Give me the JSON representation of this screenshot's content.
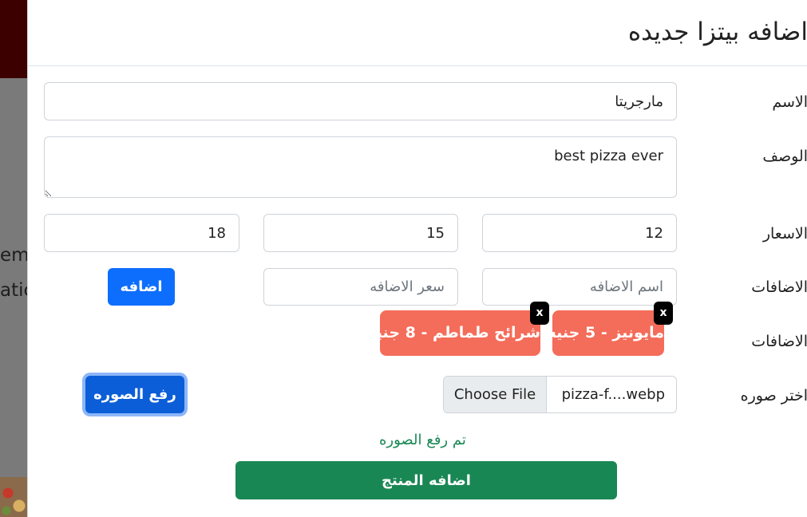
{
  "background": {
    "text_line1": "em",
    "text_line2": "atic"
  },
  "modal": {
    "title": "اضافه بيتزا جديده",
    "name": {
      "label": "الاسم",
      "value": "مارجريتا"
    },
    "description": {
      "label": "الوصف",
      "value": "best pizza ever"
    },
    "prices": {
      "label": "الاسعار",
      "values": [
        "12",
        "15",
        "18"
      ]
    },
    "addon_input": {
      "label": "الاضافات",
      "name_placeholder": "اسم الاضافه",
      "price_placeholder": "سعر الاضافه",
      "add_button": "اضافه"
    },
    "addons_list": {
      "label": "الاضافات",
      "chips": [
        {
          "text": "مايونيز - 5 جنيه",
          "remove": "x"
        },
        {
          "text": "شرائح طماطم - 8 جنيه",
          "remove": "x"
        }
      ]
    },
    "image": {
      "label": "اختر صوره",
      "choose_file": "Choose File",
      "file_name": "pizza-f....webp",
      "upload_button": "رفع الصوره",
      "status": "تم رفع الصوره"
    },
    "submit_button": "اضافه المنتج"
  },
  "colors": {
    "primary": "#0d6efd",
    "success": "#198754",
    "chip": "#f46c5a"
  }
}
